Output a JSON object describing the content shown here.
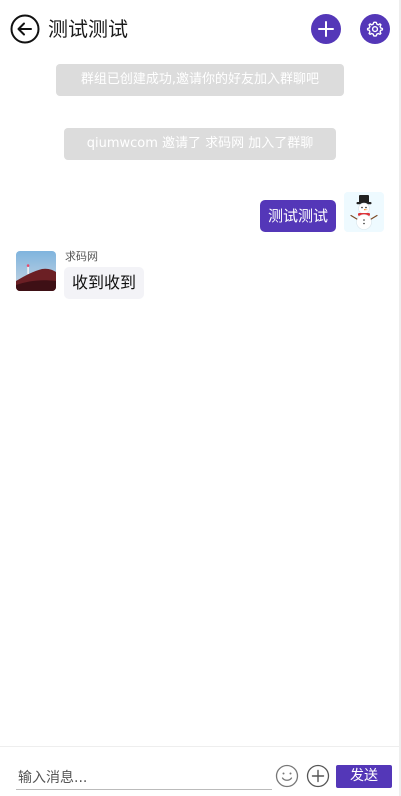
{
  "header": {
    "title": "测试测试",
    "back_icon": "arrow-left-circle-icon",
    "add_icon": "plus-icon",
    "settings_icon": "gear-icon"
  },
  "notices": [
    {
      "text": "群组已创建成功,邀请你的好友加入群聊吧"
    },
    {
      "text": "qiumwcom 邀请了 求码网 加入了群聊"
    }
  ],
  "messages": [
    {
      "from": "me",
      "text": "测试测试",
      "avatar_icon": "snowman-icon"
    },
    {
      "from": "other",
      "sender": "求码网",
      "text": "收到收到",
      "avatar_icon": "mountain-photo-icon"
    }
  ],
  "input_bar": {
    "placeholder": "输入消息...",
    "value": "",
    "emoji_icon": "smiley-icon",
    "plus_icon": "plus-circle-icon",
    "send_label": "发送"
  },
  "colors": {
    "accent": "#5437b8",
    "notice_bg": "#dcdcdc",
    "incoming_bubble": "#f3f3f7"
  }
}
